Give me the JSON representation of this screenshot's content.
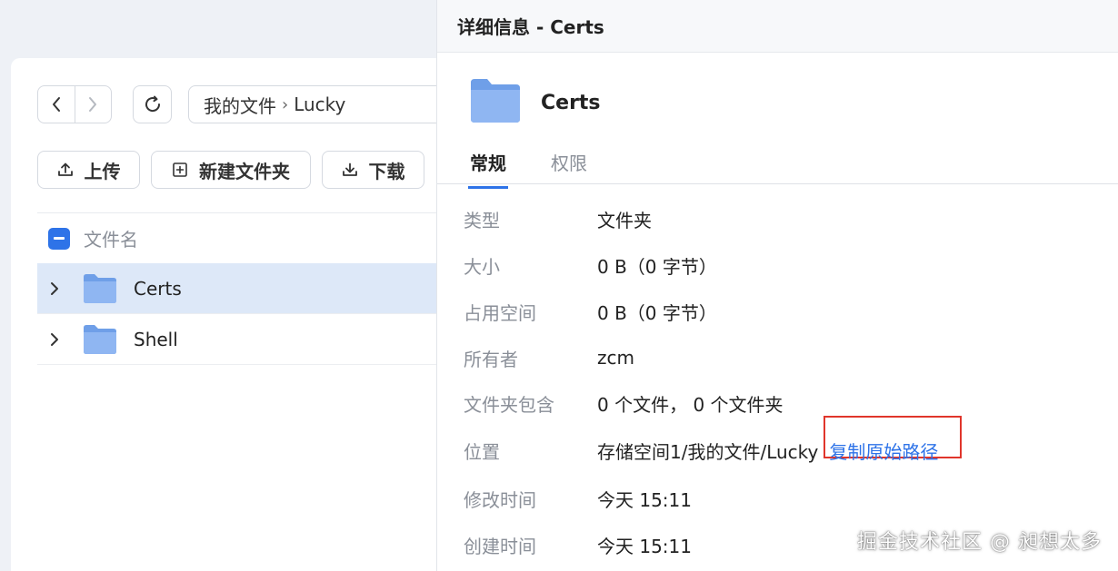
{
  "file_manager": {
    "nav": {
      "back_icon": "chevron-left-icon",
      "forward_icon": "chevron-right-icon",
      "refresh_icon": "refresh-icon"
    },
    "breadcrumb": {
      "root": "我的文件",
      "separator": "›",
      "current": "Lucky"
    },
    "toolbar": {
      "upload_label": "上传",
      "new_folder_label": "新建文件夹",
      "download_label": "下载"
    },
    "list": {
      "header_name": "文件名",
      "rows": [
        {
          "name": "Certs",
          "selected": true
        },
        {
          "name": "Shell",
          "selected": false
        }
      ]
    }
  },
  "details": {
    "header_title": "详细信息 - Certs",
    "item_name": "Certs",
    "tabs": [
      {
        "label": "常规",
        "active": true
      },
      {
        "label": "权限",
        "active": false
      }
    ],
    "fields": [
      {
        "key": "类型",
        "value": "文件夹"
      },
      {
        "key": "大小",
        "value": "0 B（0 字节）"
      },
      {
        "key": "占用空间",
        "value": "0 B（0 字节）"
      },
      {
        "key": "所有者",
        "value": "zcm"
      },
      {
        "key": "文件夹包含",
        "value": "0 个文件， 0 个文件夹"
      },
      {
        "key": "位置",
        "value": "存储空间1/我的文件/Lucky",
        "link": "复制原始路径"
      },
      {
        "key": "修改时间",
        "value": "今天 15:11"
      },
      {
        "key": "创建时间",
        "value": "今天 15:11"
      }
    ]
  },
  "watermark": "掘金技术社区 @ 昶想太多",
  "colors": {
    "accent": "#2e73e8",
    "highlight_box": "#e0352b",
    "selected_row": "#dde8f8",
    "folder": "#7aa7f0"
  }
}
